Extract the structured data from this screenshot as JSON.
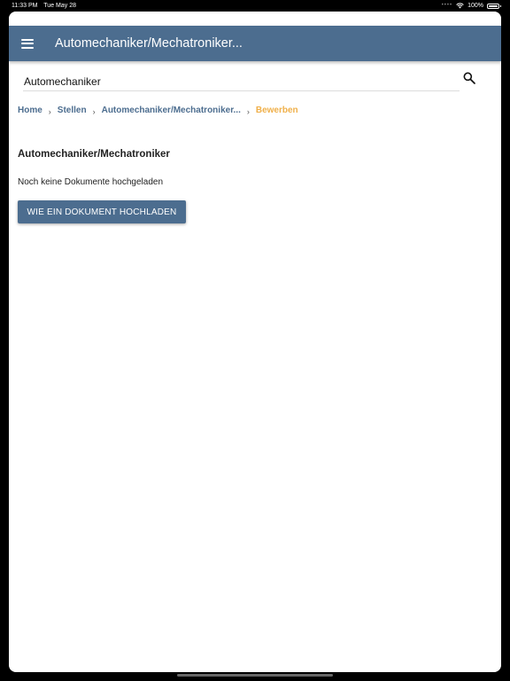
{
  "status_bar": {
    "time": "11:33 PM",
    "date": "Tue May 28",
    "battery": "100%",
    "icons": [
      "signal-dots-icon",
      "wifi-icon",
      "battery-icon"
    ]
  },
  "app_bar": {
    "title": "Automechaniker/Mechatroniker...",
    "menu_icon": "hamburger-menu-icon"
  },
  "search": {
    "value": "Automechaniker",
    "icon": "search-icon"
  },
  "breadcrumb": {
    "items": [
      {
        "label": "Home"
      },
      {
        "label": "Stellen"
      },
      {
        "label": "Automechaniker/Mechatroniker..."
      },
      {
        "label": "Bewerben"
      }
    ],
    "separator": "›"
  },
  "main": {
    "section_title": "Automechaniker/Mechatroniker",
    "empty_text": "Noch keine Dokumente hochgeladen",
    "upload_button_label": "WIE EIN DOKUMENT HOCHLADEN"
  },
  "colors": {
    "primary": "#4c6d8f",
    "accent": "#f0b04a",
    "text": "#222222"
  }
}
